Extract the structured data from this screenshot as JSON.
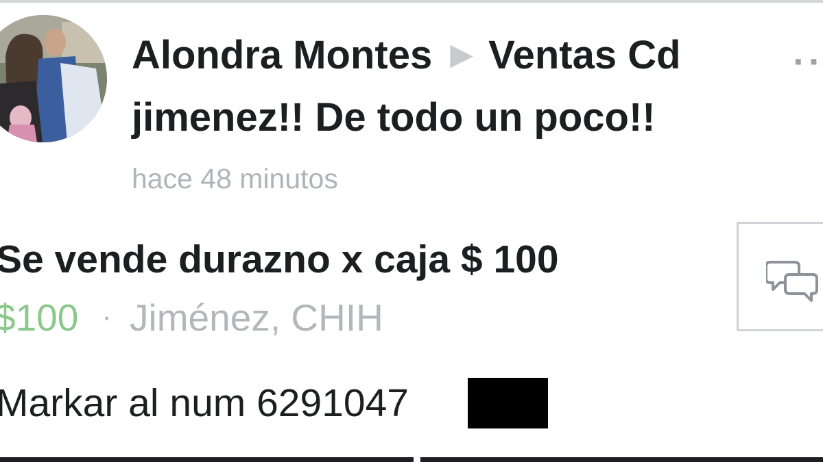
{
  "post": {
    "author": "Alondra Montes",
    "group_line1": "Ventas Cd",
    "group_line2": "jimenez!! De todo un poco!!",
    "arrow_icon": "right-triangle-icon",
    "more_icon": "more-options-icon",
    "timestamp": "hace 48 minutos"
  },
  "listing": {
    "title": "Se vende durazno x caja $ 100",
    "price": "$100",
    "separator": "·",
    "location": "Jiménez, CHIH",
    "body": "Markar al num 6291047",
    "message_icon": "message-bubbles-icon"
  },
  "colors": {
    "price": "#8bc88b",
    "secondary_text": "#b0b3b8",
    "primary_text": "#1c1e21",
    "redaction": "#000000"
  }
}
